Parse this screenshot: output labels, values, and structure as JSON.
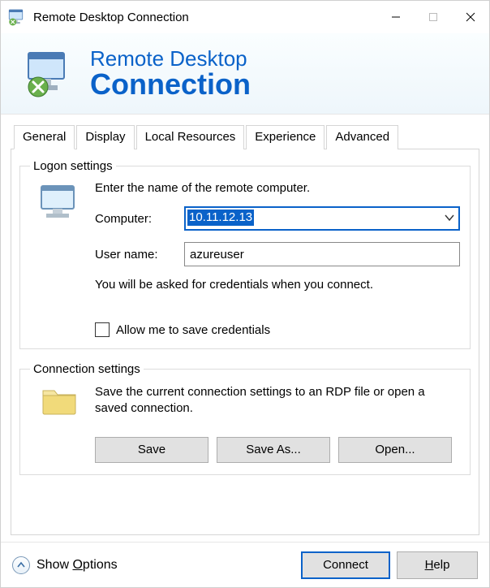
{
  "window": {
    "title": "Remote Desktop Connection"
  },
  "banner": {
    "line1": "Remote Desktop",
    "line2": "Connection"
  },
  "tabs": {
    "general": "General",
    "display": "Display",
    "local": "Local Resources",
    "experience": "Experience",
    "advanced": "Advanced"
  },
  "logon": {
    "legend": "Logon settings",
    "prompt": "Enter the name of the remote computer.",
    "computer_label": "Computer:",
    "computer_value": "10.11.12.13",
    "username_label": "User name:",
    "username_value": "azureuser",
    "cred_hint": "You will be asked for credentials when you connect.",
    "save_creds": "Allow me to save credentials"
  },
  "conn": {
    "legend": "Connection settings",
    "text": "Save the current connection settings to an RDP file or open a saved connection.",
    "save": "Save",
    "save_as": "Save As...",
    "open": "Open..."
  },
  "footer": {
    "show_options": "Show Options",
    "connect": "Connect",
    "help": "Help"
  }
}
